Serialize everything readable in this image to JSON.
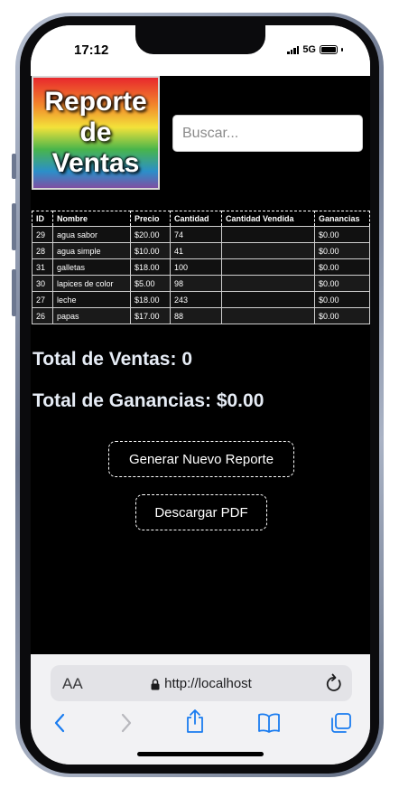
{
  "status": {
    "time": "17:12",
    "network": "5G"
  },
  "page": {
    "logo_lines": [
      "Reporte",
      "de",
      "Ventas"
    ],
    "search_placeholder": "Buscar...",
    "table": {
      "headers": [
        "ID",
        "Nombre",
        "Precio",
        "Cantidad",
        "Cantidad Vendida",
        "Ganancias"
      ],
      "rows": [
        [
          "29",
          "agua sabor",
          "$20.00",
          "74",
          "",
          "$0.00"
        ],
        [
          "28",
          "agua simple",
          "$10.00",
          "41",
          "",
          "$0.00"
        ],
        [
          "31",
          "galletas",
          "$18.00",
          "100",
          "",
          "$0.00"
        ],
        [
          "30",
          "lapices de color",
          "$5.00",
          "98",
          "",
          "$0.00"
        ],
        [
          "27",
          "leche",
          "$18.00",
          "243",
          "",
          "$0.00"
        ],
        [
          "26",
          "papas",
          "$17.00",
          "88",
          "",
          "$0.00"
        ]
      ]
    },
    "total_ventas": "Total de Ventas: 0",
    "total_ganancias": "Total de Ganancias: $0.00",
    "btn_generar": "Generar Nuevo Reporte",
    "btn_pdf": "Descargar PDF"
  },
  "browser": {
    "text_size_label": "AA",
    "url": "http://localhost",
    "icons": [
      "lock-icon",
      "reload-icon",
      "back-icon",
      "forward-icon",
      "share-icon",
      "bookmarks-icon",
      "tabs-icon"
    ],
    "accent_color": "#1a7cf0"
  }
}
